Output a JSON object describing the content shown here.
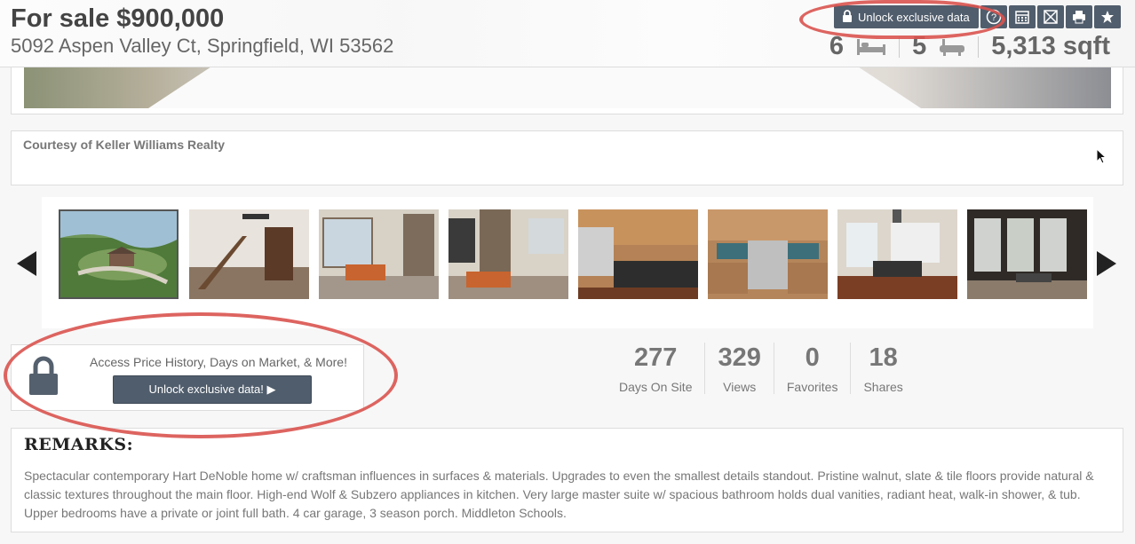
{
  "header": {
    "price": "For sale $900,000",
    "address": "5092 Aspen Valley Ct, Springfield, WI 53562",
    "beds": "6",
    "baths": "5",
    "sqft": "5,313 sqft"
  },
  "toolbar": {
    "unlock_label": "Unlock exclusive data",
    "buttons": [
      "help-icon",
      "calendar-icon",
      "email-icon",
      "print-icon",
      "star-icon"
    ]
  },
  "courtesy": "Courtesy of Keller Williams Realty",
  "gallery": {
    "thumbnails": [
      {
        "name": "aerial-house"
      },
      {
        "name": "entry-staircase"
      },
      {
        "name": "living-room-windows"
      },
      {
        "name": "living-room-fireplace"
      },
      {
        "name": "kitchen-island"
      },
      {
        "name": "kitchen-range"
      },
      {
        "name": "dining-room"
      },
      {
        "name": "sunroom-porch"
      }
    ]
  },
  "unlock_box": {
    "text": "Access Price History, Days on Market, & More!",
    "button": "Unlock exclusive data! ▶"
  },
  "counts": [
    {
      "num": "277",
      "label": "Days On Site"
    },
    {
      "num": "329",
      "label": "Views"
    },
    {
      "num": "0",
      "label": "Favorites"
    },
    {
      "num": "18",
      "label": "Shares"
    }
  ],
  "remarks": {
    "title": "REMARKS:",
    "body": "Spectacular contemporary Hart DeNoble home w/ craftsman influences in surfaces & materials. Upgrades to even the smallest details standout. Pristine walnut, slate & tile floors provide natural & classic textures throughout the main floor. High-end Wolf & Subzero appliances in kitchen. Very large master suite w/ spacious bathroom holds dual vanities, radiant heat, walk-in shower, & tub. Upper bedrooms have a private or joint full bath. 4 car garage, 3 season porch. Middleton Schools."
  },
  "colors": {
    "button": "#505d6c",
    "annotation": "#d9534f"
  }
}
